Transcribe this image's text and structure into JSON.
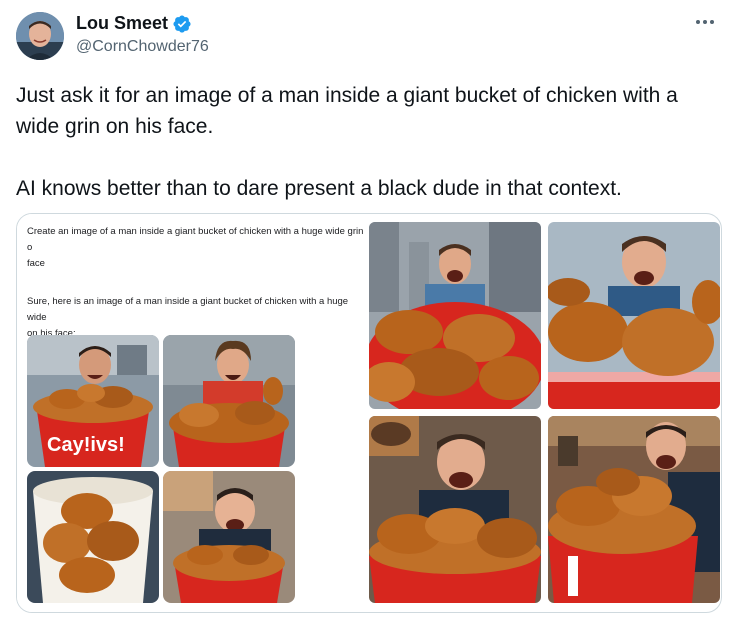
{
  "user": {
    "display_name": "Lou Smeet",
    "handle": "@CornChowder76",
    "verified": true,
    "avatar_icon": "profile-photo"
  },
  "tweet": {
    "text": "Just ask it for an image of a man inside a giant bucket of chicken with a wide grin on his face.\n\nAI knows better than to dare present a black dude in that context."
  },
  "media": {
    "screenshot": {
      "prompt": "Create an image of a man inside a giant bucket of chicken with a huge wide grin o\nface",
      "reply": "Sure, here is an image of a man inside a giant bucket of chicken with a huge wide\non his face:",
      "bucket_text": "Cay!ivs!"
    }
  },
  "colors": {
    "verified_blue": "#1d9bf0",
    "bucket_red": "#d7261e",
    "chicken_brown": "#b8641c",
    "secondary_text": "#536471"
  },
  "icons": {
    "more": "more-horizontal-icon",
    "verified": "verified-badge-icon"
  }
}
